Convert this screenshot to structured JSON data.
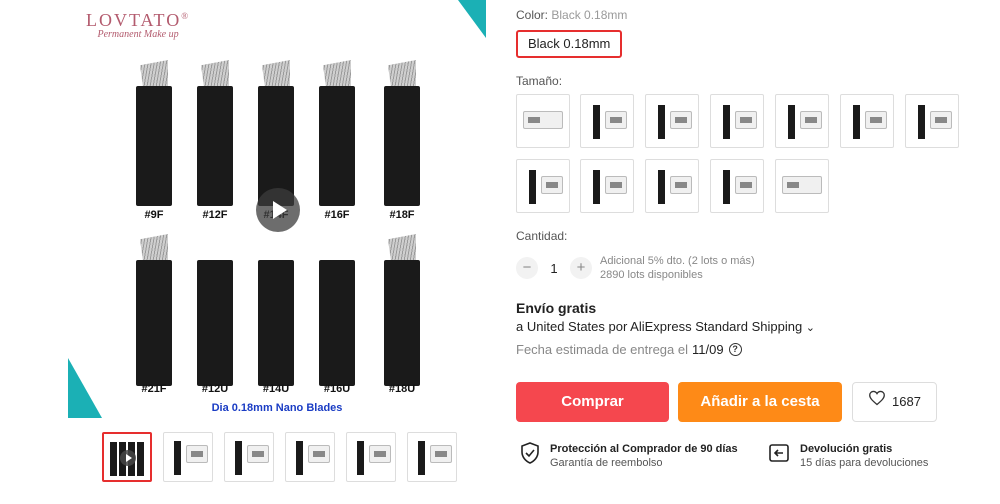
{
  "brand": {
    "name": "LOVTATO",
    "reg": "®",
    "tagline": "Permanent Make up"
  },
  "product_image": {
    "row1_labels": [
      "#9F",
      "#12F",
      "#14F",
      "#16F",
      "#18F"
    ],
    "row2_labels": [
      "#21F",
      "#12U",
      "#14U",
      "#16U",
      "#18U"
    ],
    "caption": "Dia 0.18mm Nano Blades"
  },
  "color": {
    "label": "Color:",
    "selected_value": "Black 0.18mm",
    "chip_label": "Black 0.18mm"
  },
  "size": {
    "label": "Tamaño:"
  },
  "quantity": {
    "label": "Cantidad:",
    "minus": "−",
    "value": "1",
    "plus": "+",
    "discount": "Adicional 5% dto. (2 lots o más)",
    "available": "2890 lots disponibles"
  },
  "shipping": {
    "title": "Envío gratis",
    "destination": "a United States por AliExpress Standard Shipping",
    "destination_chevron": "⌄",
    "date_label": "Fecha estimada de entrega el",
    "date_value": "11/09",
    "help_icon": "?"
  },
  "actions": {
    "buy": "Comprar",
    "add_to_cart": "Añadir a la cesta",
    "wishlist_count": "1687"
  },
  "guarantees": [
    {
      "title": "Protección al Comprador de 90 días",
      "subtitle": "Garantía de reembolso"
    },
    {
      "title": "Devolución gratis",
      "subtitle": "15 días para devoluciones"
    }
  ],
  "colors": {
    "primary_red": "#f5474e",
    "cart_orange": "#fe8a17",
    "selected_border": "#e62e2e",
    "brand_pink": "#b35b6e",
    "caption_blue": "#1a3cc4"
  }
}
